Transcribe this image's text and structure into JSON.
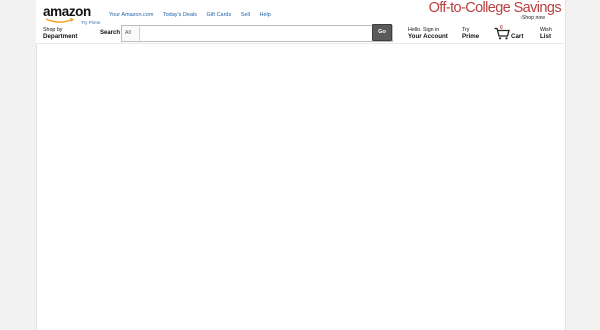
{
  "logo": {
    "text": "amazon",
    "try_prime": "Try Prime"
  },
  "nav_links": [
    "Your Amazon.com",
    "Today's Deals",
    "Gift Cards",
    "Sell",
    "Help"
  ],
  "promo": {
    "title": "Off-to-College Savings",
    "shop_now": "Shop now"
  },
  "department": {
    "line1": "Shop by",
    "line2": "Department"
  },
  "search": {
    "label": "Search",
    "scope": "All",
    "value": "",
    "go": "Go"
  },
  "account": {
    "line1": "Hello. Sign in",
    "line2": "Your Account"
  },
  "prime": {
    "line1": "Try",
    "line2": "Prime"
  },
  "cart": {
    "count": "0",
    "label": "Cart"
  },
  "wishlist": {
    "line1": "Wish",
    "line2": "List"
  },
  "colors": {
    "link": "#2262a8",
    "promo": "#b8413f",
    "go_button": "#5a5a5a"
  }
}
